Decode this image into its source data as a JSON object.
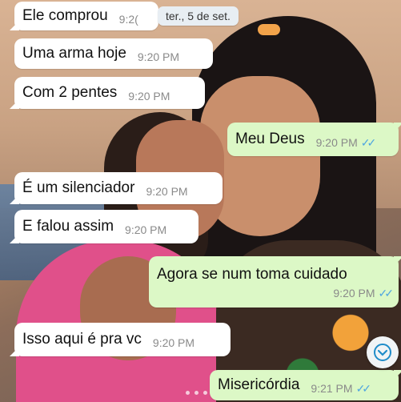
{
  "date_chip": "ter., 5 de set.",
  "messages": [
    {
      "dir": "in",
      "text": "Ele comprou",
      "time": "9:2("
    },
    {
      "dir": "in",
      "text": "Uma arma hoje",
      "time": "9:20 PM"
    },
    {
      "dir": "in",
      "text": "Com 2 pentes",
      "time": "9:20 PM"
    },
    {
      "dir": "out",
      "text": "Meu Deus",
      "time": "9:20 PM"
    },
    {
      "dir": "in",
      "text": "É um silenciador",
      "time": "9:20 PM"
    },
    {
      "dir": "in",
      "text": "E falou assim",
      "time": "9:20 PM"
    },
    {
      "dir": "out",
      "text": "Agora se num toma cuidado",
      "time": "9:20 PM"
    },
    {
      "dir": "in",
      "text": "Isso aqui é pra vc",
      "time": "9:20 PM"
    },
    {
      "dir": "out",
      "text": "Misericórdia",
      "time": "9:21 PM"
    }
  ],
  "icons": {
    "read_ticks": "double-check-icon",
    "scroll": "chevron-down-icon"
  },
  "colors": {
    "incoming": "#ffffff",
    "outgoing": "#dcf8c6",
    "ticks": "#4fa6e0"
  }
}
